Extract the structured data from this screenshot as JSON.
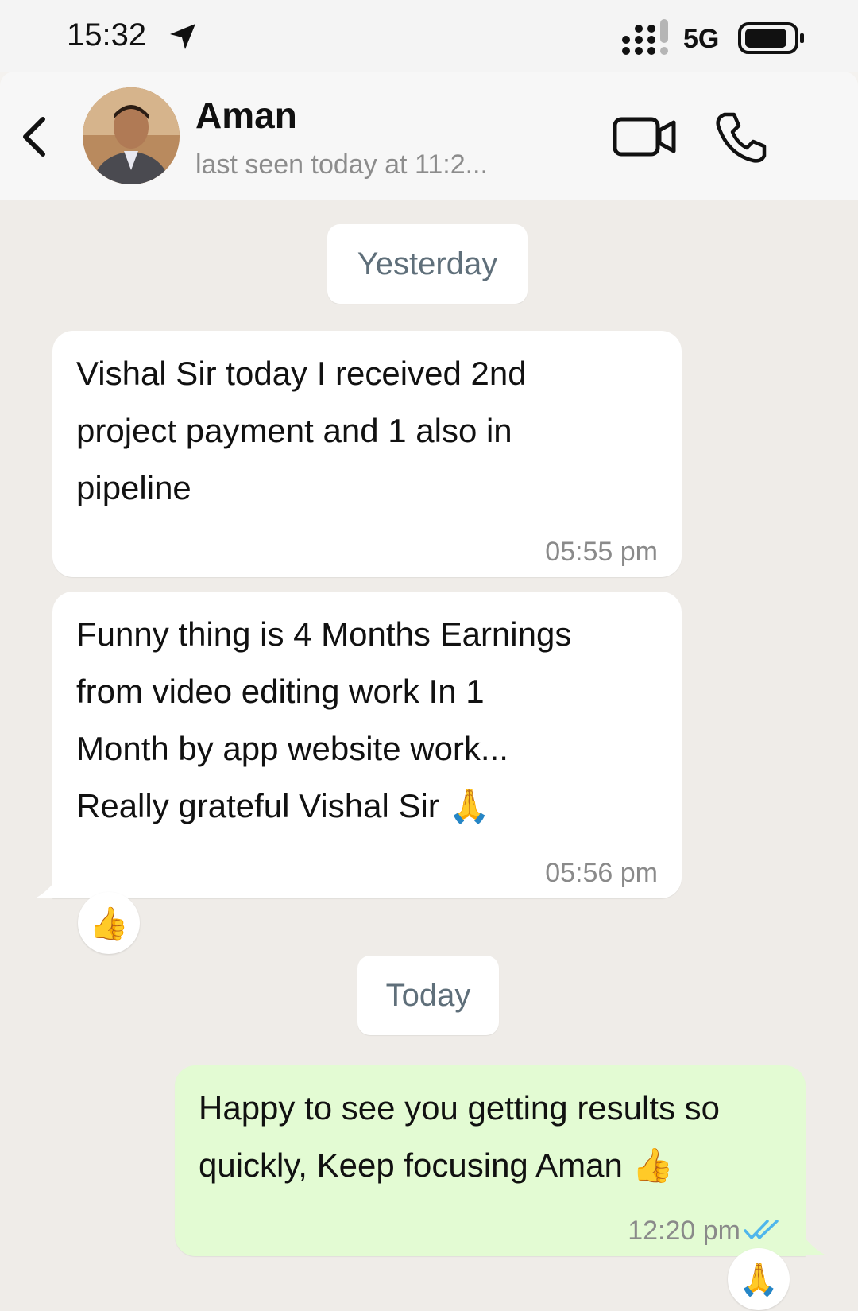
{
  "status_bar": {
    "time": "15:32",
    "network": "5G",
    "icons": [
      "location-arrow-icon",
      "signal-icon",
      "battery-icon"
    ]
  },
  "header": {
    "contact_name": "Aman",
    "last_seen": "last seen today at 11:2...",
    "icons": [
      "back-chevron-icon",
      "avatar",
      "video-call-icon",
      "voice-call-icon"
    ]
  },
  "chat": {
    "date_yesterday": "Yesterday",
    "date_today": "Today",
    "messages": [
      {
        "direction": "incoming",
        "lines": [
          "Vishal Sir today I received 2nd",
          "project payment and 1 also in",
          "pipeline"
        ],
        "time": "05:55 pm"
      },
      {
        "direction": "incoming",
        "lines": [
          "Funny thing is 4 Months Earnings",
          "from video editing work In 1",
          "Month by app website work...",
          "Really grateful Vishal Sir 🙏"
        ],
        "time": "05:56 pm",
        "reaction": "👍"
      },
      {
        "direction": "outgoing",
        "lines": [
          "Happy to see you getting results so",
          "quickly, Keep focusing Aman 👍"
        ],
        "time": "12:20 pm",
        "status": "read",
        "reaction": "🙏"
      }
    ]
  },
  "colors": {
    "incoming_bubble": "#ffffff",
    "outgoing_bubble": "#e3fbd3",
    "chat_background": "#efece8",
    "read_ticks": "#4fb6ec"
  }
}
